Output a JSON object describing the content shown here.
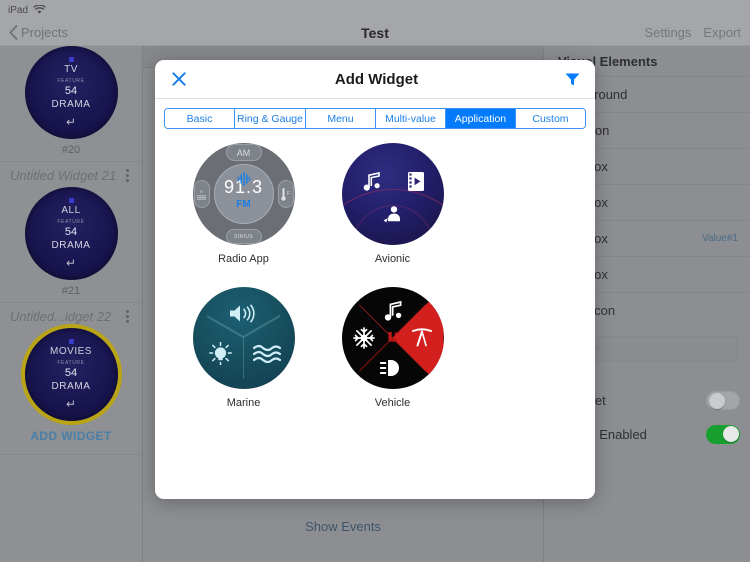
{
  "statusbar": {
    "device": "iPad",
    "wifi_icon": "wifi-icon"
  },
  "navbar": {
    "back_label": "Projects",
    "back_icon": "chevron-left-icon",
    "title": "Test",
    "settings_label": "Settings",
    "export_label": "Export"
  },
  "sidebar": {
    "groups": [
      {
        "title": "",
        "caption": "#20",
        "menu_icon": "kebab-menu-icon",
        "thumb": {
          "dot": "",
          "line1": "TV",
          "line2": "FEATURE",
          "line3": "54",
          "line4": "DRAMA",
          "back_icon": "undo-icon"
        },
        "selected": false
      },
      {
        "title": "Untitled Widget 21",
        "caption": "#21",
        "menu_icon": "kebab-menu-icon",
        "thumb": {
          "dot": "",
          "line1": "ALL",
          "line2": "FEATURE",
          "line3": "54",
          "line4": "DRAMA",
          "back_icon": "undo-icon"
        },
        "selected": false
      },
      {
        "title": "Untitled...idget 22",
        "caption": "ADD WIDGET",
        "menu_icon": "kebab-menu-icon",
        "thumb": {
          "dot": "",
          "line1": "MOVIES",
          "line2": "FEATURE",
          "line3": "54",
          "line4": "DRAMA",
          "back_icon": "undo-icon"
        },
        "selected": true
      }
    ]
  },
  "canvas": {
    "show_events_label": "Show Events"
  },
  "inspector": {
    "title": "Visual Elements",
    "rows": [
      {
        "label": "Background",
        "value": ""
      },
      {
        "label": "App Icon",
        "value": ""
      },
      {
        "label": "Text Box",
        "value": ""
      },
      {
        "label": "Text Box",
        "value": ""
      },
      {
        "label": "Text Box",
        "value": "Value#1"
      },
      {
        "label": "Text Box",
        "value": ""
      },
      {
        "label": "Back Icon",
        "value": ""
      }
    ],
    "name_placeholder": "Name",
    "section_label": "n",
    "toggles": [
      {
        "label": "t Widget",
        "state": "off"
      },
      {
        "label": "Button Enabled",
        "state": "on"
      }
    ]
  },
  "modal": {
    "title": "Add Widget",
    "close_icon": "close-icon",
    "filter_icon": "funnel-filter-icon",
    "tabs": [
      {
        "label": "Basic",
        "active": false
      },
      {
        "label": "Ring & Gauge",
        "active": false
      },
      {
        "label": "Menu",
        "active": false
      },
      {
        "label": "Multi-value",
        "active": false
      },
      {
        "label": "Application",
        "active": true
      },
      {
        "label": "Custom",
        "active": false
      }
    ],
    "accent_color": "#047bfa",
    "widgets": [
      {
        "label": "Radio App",
        "kind": "radio",
        "frequency": "91.3",
        "band": "FM",
        "btn_top": "AM",
        "btn_bottom": "SIRIUS",
        "btn_left": "B\nCOM",
        "btn_right": "F"
      },
      {
        "label": "Avionic",
        "kind": "avionic",
        "icons": [
          "music-note-icon",
          "video-film-icon",
          "person-service-icon"
        ]
      },
      {
        "label": "Marine",
        "kind": "marine",
        "icons": [
          "speaker-volume-icon",
          "light-bulb-icon",
          "water-waves-icon"
        ]
      },
      {
        "label": "Vehicle",
        "kind": "vehicle",
        "icons": [
          "music-note-icon",
          "snowflake-ac-icon",
          "windshield-wiper-icon",
          "headlight-icon",
          "seat-heater-icon"
        ]
      }
    ]
  }
}
